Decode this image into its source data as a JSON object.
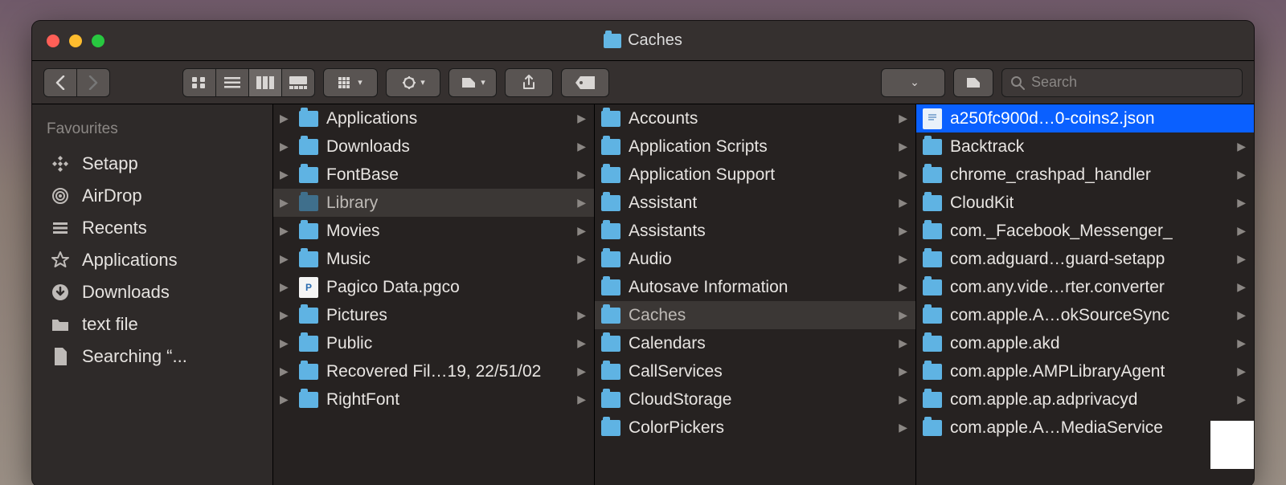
{
  "window": {
    "title": "Caches"
  },
  "search": {
    "placeholder": "Search"
  },
  "sidebar": {
    "header": "Favourites",
    "items": [
      {
        "icon": "setapp",
        "label": "Setapp"
      },
      {
        "icon": "airdrop",
        "label": "AirDrop"
      },
      {
        "icon": "recents",
        "label": "Recents"
      },
      {
        "icon": "apps",
        "label": "Applications"
      },
      {
        "icon": "download",
        "label": "Downloads"
      },
      {
        "icon": "folder",
        "label": "text file"
      },
      {
        "icon": "doc",
        "label": "Searching “..."
      }
    ]
  },
  "columns": [
    {
      "items": [
        {
          "name": "Applications",
          "type": "folder",
          "children": true
        },
        {
          "name": "Downloads",
          "type": "folder",
          "children": true
        },
        {
          "name": "FontBase",
          "type": "folder",
          "children": true
        },
        {
          "name": "Library",
          "type": "folder",
          "children": true,
          "path": true,
          "dim": true
        },
        {
          "name": "Movies",
          "type": "folder",
          "children": true
        },
        {
          "name": "Music",
          "type": "folder",
          "children": true
        },
        {
          "name": "Pagico Data.pgco",
          "type": "file"
        },
        {
          "name": "Pictures",
          "type": "folder",
          "children": true
        },
        {
          "name": "Public",
          "type": "folder",
          "children": true
        },
        {
          "name": "Recovered Fil…19, 22/51/02",
          "type": "folder",
          "children": true
        },
        {
          "name": "RightFont",
          "type": "folder",
          "children": true
        }
      ]
    },
    {
      "items": [
        {
          "name": "Accounts",
          "type": "folder",
          "children": true
        },
        {
          "name": "Application Scripts",
          "type": "folder",
          "children": true
        },
        {
          "name": "Application Support",
          "type": "folder",
          "children": true
        },
        {
          "name": "Assistant",
          "type": "folder",
          "children": true
        },
        {
          "name": "Assistants",
          "type": "folder",
          "children": true
        },
        {
          "name": "Audio",
          "type": "folder",
          "children": true
        },
        {
          "name": "Autosave Information",
          "type": "folder",
          "children": true
        },
        {
          "name": "Caches",
          "type": "folder",
          "children": true,
          "path": true
        },
        {
          "name": "Calendars",
          "type": "folder",
          "children": true
        },
        {
          "name": "CallServices",
          "type": "folder",
          "children": true
        },
        {
          "name": "CloudStorage",
          "type": "folder",
          "children": true
        },
        {
          "name": "ColorPickers",
          "type": "folder",
          "children": true
        }
      ]
    },
    {
      "items": [
        {
          "name": "a250fc900d…0-coins2.json",
          "type": "json",
          "selected": true
        },
        {
          "name": "Backtrack",
          "type": "folder",
          "children": true
        },
        {
          "name": "chrome_crashpad_handler",
          "type": "folder",
          "children": true
        },
        {
          "name": "CloudKit",
          "type": "folder",
          "children": true
        },
        {
          "name": "com._Facebook_Messenger_",
          "type": "folder",
          "children": true
        },
        {
          "name": "com.adguard…guard-setapp",
          "type": "folder",
          "children": true
        },
        {
          "name": "com.any.vide…rter.converter",
          "type": "folder",
          "children": true
        },
        {
          "name": "com.apple.A…okSourceSync",
          "type": "folder",
          "children": true
        },
        {
          "name": "com.apple.akd",
          "type": "folder",
          "children": true
        },
        {
          "name": "com.apple.AMPLibraryAgent",
          "type": "folder",
          "children": true
        },
        {
          "name": "com.apple.ap.adprivacyd",
          "type": "folder",
          "children": true
        },
        {
          "name": "com.apple.A…MediaService",
          "type": "folder",
          "children": true
        }
      ]
    }
  ]
}
